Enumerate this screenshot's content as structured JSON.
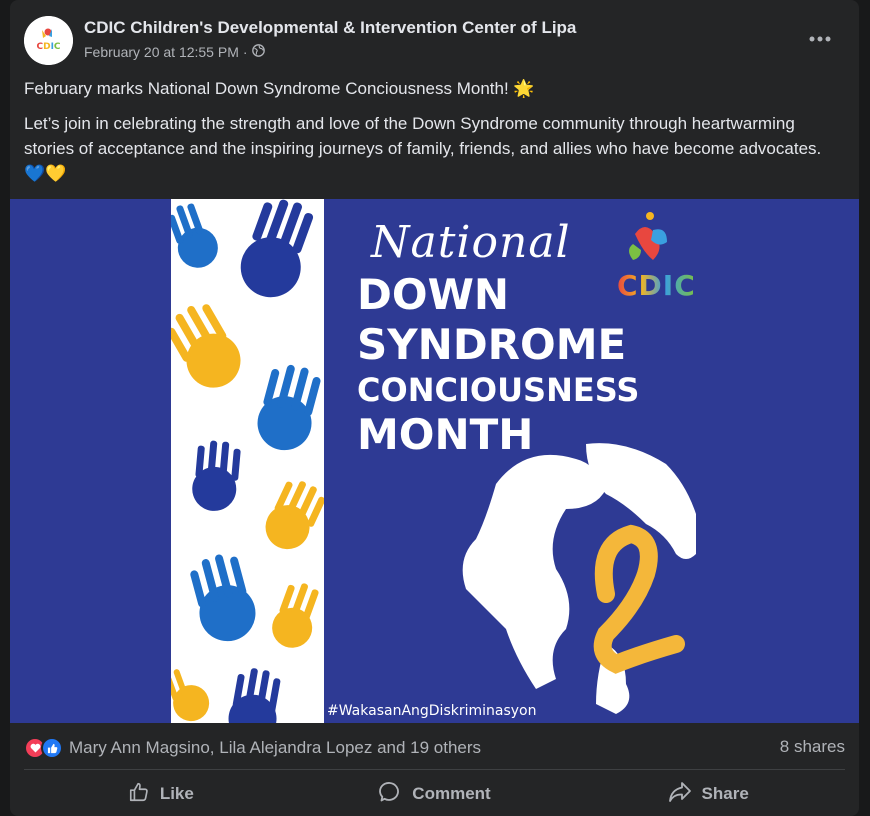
{
  "post": {
    "page_name": "CDIC Children's Developmental & Intervention Center of Lipa",
    "timestamp": "February 20 at 12:55 PM",
    "separator": "·",
    "avatar_text": "CDIC",
    "paragraph_1": "February marks National Down Syndrome Conciousness Month! 🌟",
    "paragraph_2": "Let’s join in celebrating the strength and love of the Down Syndrome community through heartwarming stories of acceptance and the inspiring journeys of family, friends, and allies who have become advocates. 💙💛"
  },
  "poster": {
    "script_word": "National",
    "line1": "DOWN",
    "line2": "SYNDROME",
    "line3": "CONCIOUSNESS",
    "line4": "MONTH",
    "logo_text": "CDIC",
    "hashtag": "#WakasanAngDiskriminasyon",
    "colors": {
      "background": "#2e3a94",
      "hand_yellow": "#f5b520",
      "hand_blue": "#1f6fc8",
      "hand_navy": "#243a9c",
      "ribbon": "#f4b73a"
    }
  },
  "reactions": {
    "names": "Mary Ann Magsino, Lila Alejandra Lopez and 19 others",
    "shares": "8 shares",
    "icons": [
      "love-icon",
      "like-icon"
    ]
  },
  "actions": {
    "like": "Like",
    "comment": "Comment",
    "share": "Share"
  },
  "colors": {
    "card_bg": "#242526",
    "text": "#e4e6eb",
    "muted": "#b0b3b8",
    "love": "#f33e58",
    "like": "#2078f4"
  }
}
